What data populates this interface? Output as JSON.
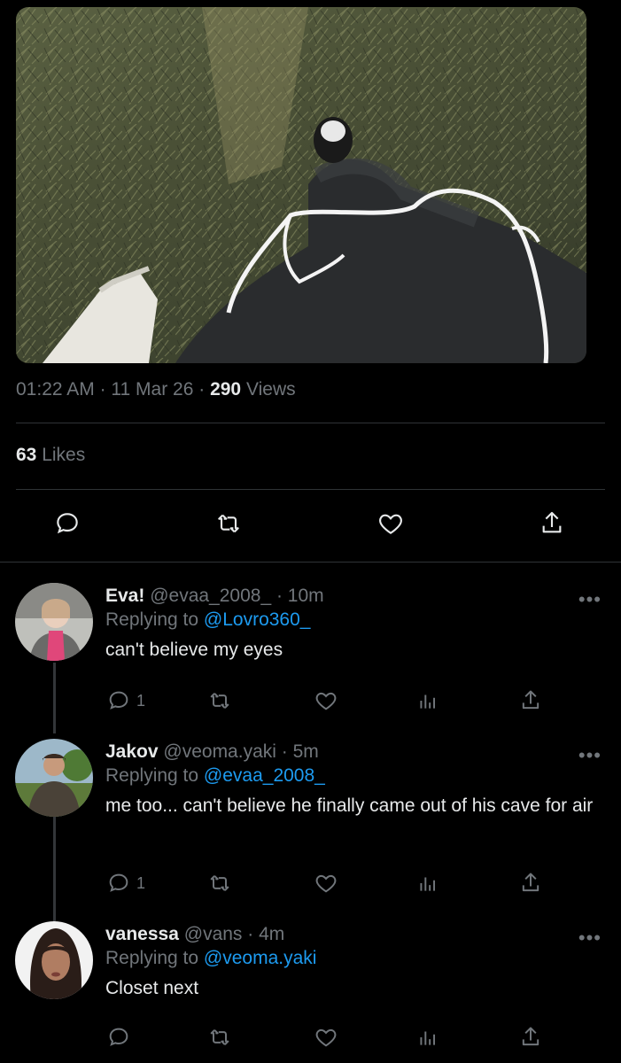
{
  "tweet": {
    "image_alt": "Photo of legs in dark pants on grass with white earphone cable",
    "time": "01:22 AM",
    "date": "11 Mar 26",
    "views_count": "290",
    "views_label": "Views",
    "likes_count": "63",
    "likes_label": "Likes",
    "actions": [
      "reply-icon",
      "retweet-icon",
      "like-icon",
      "share-icon"
    ]
  },
  "replies": [
    {
      "name": "Eva!",
      "handle": "@evaa_2008_",
      "time": "· 10m",
      "replying_prefix": "Replying to",
      "replying_to": "@Lovro360_",
      "text": "can't believe my eyes",
      "reply_count": "1",
      "avatar_colors": [
        "#d8d8d8",
        "#e0477a"
      ]
    },
    {
      "name": "Jakov",
      "handle": "@veoma.yaki",
      "time": "· 5m",
      "replying_prefix": "Replying to",
      "replying_to": "@evaa_2008_",
      "text": "me too... can't believe he finally came out of his cave for air",
      "reply_count": "1",
      "avatar_colors": [
        "#9db8c9",
        "#4a4238"
      ]
    },
    {
      "name": "vanessa",
      "handle": "@vans",
      "time": "· 4m",
      "replying_prefix": "Replying to",
      "replying_to": "@veoma.yaki",
      "text": "Closet next",
      "reply_count": "",
      "avatar_colors": [
        "#f2f2f2",
        "#2a1d18"
      ]
    }
  ],
  "colors": {
    "background": "#000000",
    "text": "#e7e9ea",
    "muted": "#71767b",
    "link": "#1d9bf0",
    "divider": "#2f3336"
  }
}
